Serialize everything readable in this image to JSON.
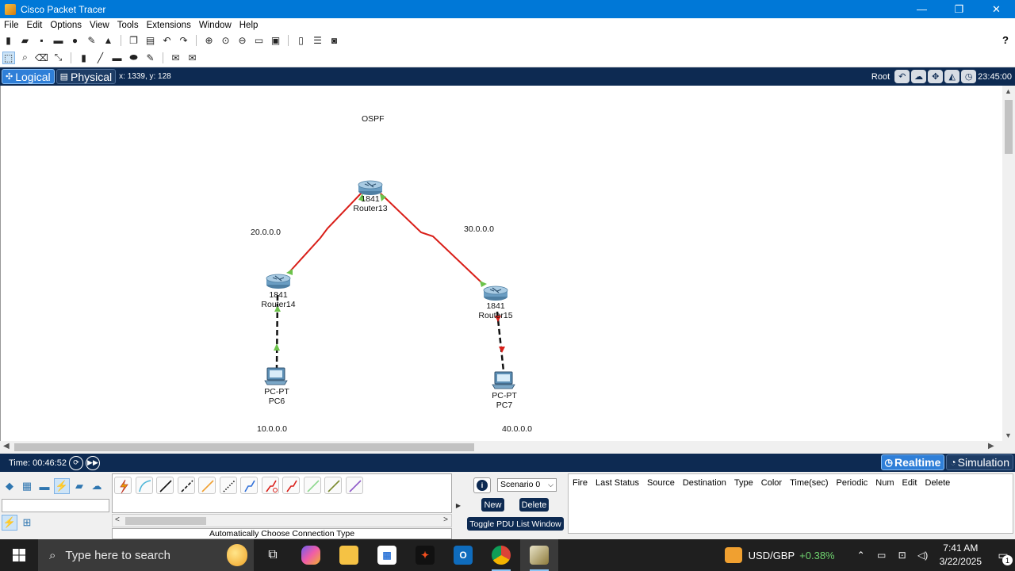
{
  "window": {
    "title": "Cisco Packet Tracer",
    "minimize": "—",
    "maximize": "❐",
    "close": "✕"
  },
  "menu": [
    "File",
    "Edit",
    "Options",
    "View",
    "Tools",
    "Extensions",
    "Window",
    "Help"
  ],
  "toolbar": {
    "help": "?"
  },
  "workspace": {
    "tab_logical": "Logical",
    "tab_physical": "Physical",
    "coords": "x: 1339, y: 128",
    "root": "Root",
    "clock": "23:45:00"
  },
  "topology": {
    "title": "OSPF",
    "networks": [
      "20.0.0.0",
      "30.0.0.0",
      "10.0.0.0",
      "40.0.0.0"
    ],
    "devices": [
      {
        "model": "1841",
        "name": "Router13"
      },
      {
        "model": "1841",
        "name": "Router14"
      },
      {
        "model": "1841",
        "name": "Router15"
      },
      {
        "model": "PC-PT",
        "name": "PC6"
      },
      {
        "model": "PC-PT",
        "name": "PC7"
      }
    ],
    "colors": {
      "serial_link": "#d91e18",
      "link_up": "#6cc24a",
      "link_down": "#d91e18"
    }
  },
  "timebar": {
    "time": "Time: 00:46:52",
    "realtime": "Realtime",
    "simulation": "Simulation"
  },
  "bottom": {
    "connection_caption": "Automatically Choose Connection Type",
    "scenario": "Scenario 0",
    "new": "New",
    "delete": "Delete",
    "toggle": "Toggle PDU List Window",
    "pdu_columns": [
      "Fire",
      "Last Status",
      "Source",
      "Destination",
      "Type",
      "Color",
      "Time(sec)",
      "Periodic",
      "Num",
      "Edit",
      "Delete"
    ]
  },
  "taskbar": {
    "search_placeholder": "Type here to search",
    "ticker_symbol": "USD/GBP",
    "ticker_change": "+0.38%",
    "time": "7:41 AM",
    "date": "3/22/2025",
    "notifications": "1"
  }
}
